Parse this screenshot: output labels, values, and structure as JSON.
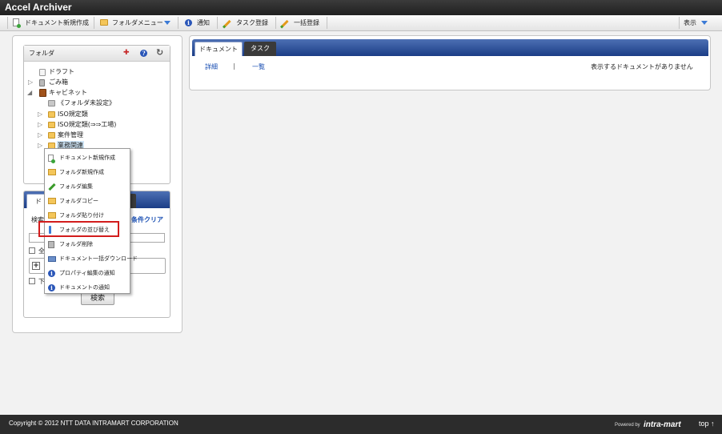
{
  "app": {
    "title": "Accel Archiver"
  },
  "toolbar": {
    "new_document": "ドキュメント新規作成",
    "folder_menu": "フォルダメニュー",
    "notify": "通知",
    "task_register": "タスク登録",
    "bulk_register": "一括登録",
    "view": "表示"
  },
  "folder_panel": {
    "title": "フォルダ",
    "tree": [
      {
        "label": "ドラフト",
        "icon": "draft-icon"
      },
      {
        "label": "ごみ箱",
        "icon": "trash-icon"
      },
      {
        "label": "キャビネット",
        "icon": "cabinet-icon"
      },
      {
        "label": "《フォルダ未設定》",
        "icon": "folder-unset-icon"
      },
      {
        "label": "ISO規定類",
        "icon": "folder-icon"
      },
      {
        "label": "ISO規定類(⇒⇒工場)",
        "icon": "folder-icon"
      },
      {
        "label": "案件管理",
        "icon": "folder-icon"
      },
      {
        "label": "業務関連",
        "icon": "folder-icon"
      }
    ]
  },
  "search_panel": {
    "tab_label": "ド",
    "search_label": "検索",
    "clear_label": "条件クリア",
    "check_all_label": "全",
    "add_label": "",
    "check_sub_label": "下",
    "search_button": "検索"
  },
  "context_menu": {
    "items": [
      {
        "label": "ドキュメント新規作成",
        "icon": "new-document-icon"
      },
      {
        "label": "フォルダ新規作成",
        "icon": "new-folder-icon"
      },
      {
        "label": "フォルダ編集",
        "icon": "edit-pencil-icon"
      },
      {
        "label": "フォルダコピー",
        "icon": "copy-folder-icon"
      },
      {
        "label": "フォルダ貼り付け",
        "icon": "paste-folder-icon"
      },
      {
        "label": "フォルダの並び替え",
        "icon": "sort-icon"
      },
      {
        "label": "フォルダ削除",
        "icon": "delete-icon"
      },
      {
        "label": "ドキュメント一括ダウンロード",
        "icon": "download-icon"
      },
      {
        "label": "プロパティ編集の通知",
        "icon": "info-icon"
      },
      {
        "label": "ドキュメントの通知",
        "icon": "info-icon"
      }
    ],
    "highlighted_index": 5
  },
  "right_panel": {
    "tabs": [
      "ドキュメント",
      "タスク"
    ],
    "active_tab": 0,
    "links": [
      "詳細",
      "一覧"
    ],
    "separator": "|",
    "empty_message": "表示するドキュメントがありません"
  },
  "footer": {
    "copyright": "Copyright © 2012 NTT DATA INTRAMART CORPORATION",
    "powered_by": "Powered by",
    "brand": "intra-mart",
    "top_link": "top ↑"
  },
  "colors": {
    "accent": "#1f4a9c",
    "highlight_border": "#d21c1c",
    "link": "#1a4fb3"
  }
}
